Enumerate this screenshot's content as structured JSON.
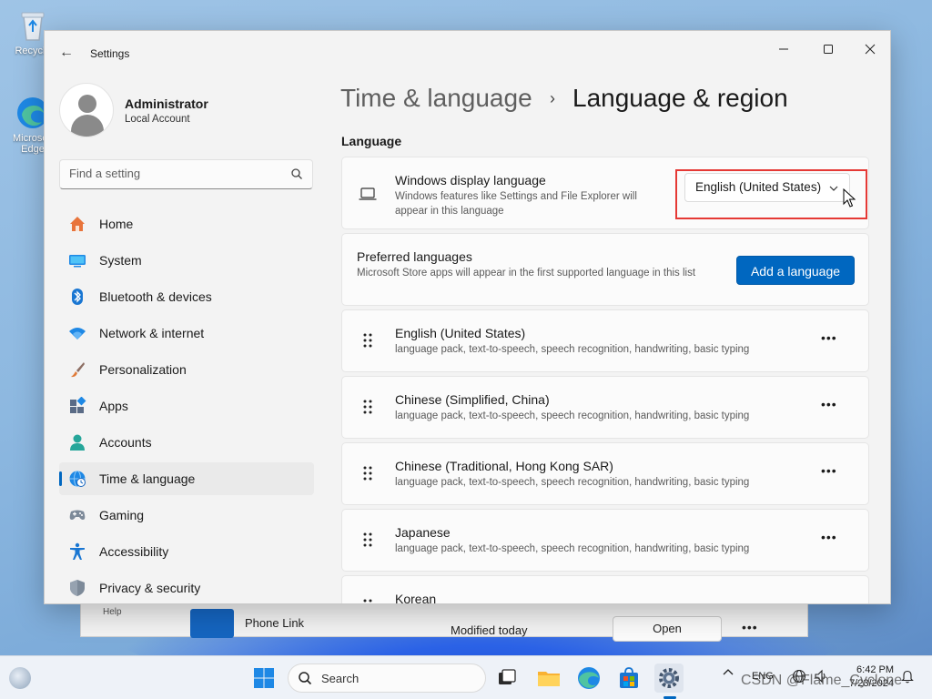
{
  "desktop": {
    "icons": [
      {
        "label": "Recycle",
        "icon": "recycle-bin-icon"
      },
      {
        "label": "Microsoft Edge",
        "icon": "edge-icon"
      }
    ]
  },
  "background_window": {
    "help": "Help",
    "app_name": "Phone Link",
    "modified": "Modified today",
    "open_label": "Open",
    "more": "•••"
  },
  "window": {
    "title": "Settings",
    "back": "←",
    "minimize": "—",
    "maximize": "☐",
    "close": "✕"
  },
  "user": {
    "name": "Administrator",
    "account_type": "Local Account"
  },
  "search": {
    "placeholder": "Find a setting"
  },
  "nav": [
    {
      "label": "Home",
      "icon": "home-icon",
      "color": "#e8743b"
    },
    {
      "label": "System",
      "icon": "system-icon",
      "color": "#1e88e5"
    },
    {
      "label": "Bluetooth & devices",
      "icon": "bluetooth-icon",
      "color": "#1976d2"
    },
    {
      "label": "Network & internet",
      "icon": "wifi-icon",
      "color": "#1e88e5"
    },
    {
      "label": "Personalization",
      "icon": "brush-icon",
      "color": "#e07b39"
    },
    {
      "label": "Apps",
      "icon": "apps-icon",
      "color": "#5a6b86"
    },
    {
      "label": "Accounts",
      "icon": "accounts-icon",
      "color": "#26a69a"
    },
    {
      "label": "Time & language",
      "icon": "globe-clock-icon",
      "color": "#1e88e5",
      "active": true
    },
    {
      "label": "Gaming",
      "icon": "gamepad-icon",
      "color": "#6d7a8a"
    },
    {
      "label": "Accessibility",
      "icon": "accessibility-icon",
      "color": "#1976d2"
    },
    {
      "label": "Privacy & security",
      "icon": "shield-icon",
      "color": "#6d7a8a"
    }
  ],
  "breadcrumb": {
    "parent": "Time & language",
    "separator": "›",
    "current": "Language & region"
  },
  "section_title": "Language",
  "display_language": {
    "title": "Windows display language",
    "description": "Windows features like Settings and File Explorer will appear in this language",
    "selected": "English (United States)"
  },
  "preferred": {
    "title": "Preferred languages",
    "description": "Microsoft Store apps will appear in the first supported language in this list",
    "add_button": "Add a language"
  },
  "languages": [
    {
      "name": "English (United States)",
      "features": "language pack, text-to-speech, speech recognition, handwriting, basic typing"
    },
    {
      "name": "Chinese (Simplified, China)",
      "features": "language pack, text-to-speech, speech recognition, handwriting, basic typing"
    },
    {
      "name": "Chinese (Traditional, Hong Kong SAR)",
      "features": "language pack, text-to-speech, speech recognition, handwriting, basic typing"
    },
    {
      "name": "Japanese",
      "features": "language pack, text-to-speech, speech recognition, handwriting, basic typing"
    },
    {
      "name": "Korean",
      "features": ""
    }
  ],
  "more_label": "•••",
  "taskbar": {
    "search_label": "Search",
    "tray_chevron": "^",
    "input_lang": "ENG",
    "time": "6:42 PM",
    "date": "7/23/2024"
  },
  "watermark": "CSDN @Flame_Cyclone",
  "colors": {
    "accent": "#0067c0",
    "highlight_box": "#e53935"
  }
}
